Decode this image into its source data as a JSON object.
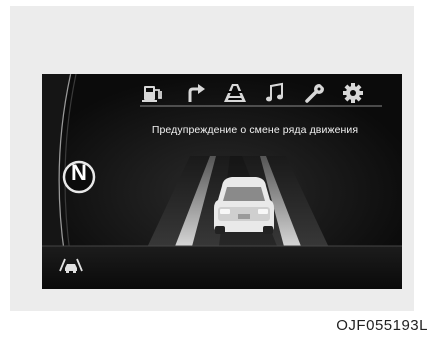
{
  "screen": {
    "message": "Предупреждение о смене ряда движения",
    "gear": "N",
    "icons": [
      {
        "name": "fuel-icon",
        "selected": false
      },
      {
        "name": "navigation-turn-icon",
        "selected": false
      },
      {
        "name": "driving-assist-icon",
        "selected": true
      },
      {
        "name": "music-icon",
        "selected": false
      },
      {
        "name": "service-wrench-icon",
        "selected": false
      },
      {
        "name": "settings-gear-icon",
        "selected": false
      }
    ],
    "status_icon": "lane-assist-car-icon"
  },
  "caption": "OJF055193L",
  "colors": {
    "background": "#0b0b0b",
    "lane_stripe": "#d8d8d8",
    "text": "#f2f2f2"
  }
}
